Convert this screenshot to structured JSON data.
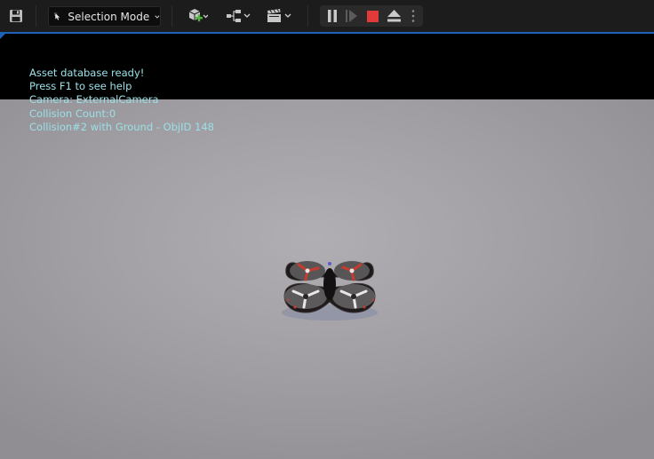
{
  "toolbar": {
    "save_icon": "save-icon",
    "mode_icon": "cursor-select-icon",
    "mode_label": "Selection Mode",
    "add_icon": "add-actor-icon",
    "blueprint_icon": "blueprint-icon",
    "cinematics_icon": "clapperboard-icon"
  },
  "playback": {
    "pause_icon": "pause-icon",
    "step_icon": "advance-frame-icon",
    "stop_icon": "stop-icon",
    "eject_icon": "eject-icon",
    "more_icon": "more-vertical-icon",
    "stop_color": "#e03a3a"
  },
  "hud": {
    "lines": [
      "Asset database ready!",
      "Press F1 to see help",
      "Camera: ExternalCamera",
      "Collision Count:0",
      "Collision#2 with Ground - ObjID 148"
    ]
  },
  "scene": {
    "object": "quadcopter-drone"
  }
}
